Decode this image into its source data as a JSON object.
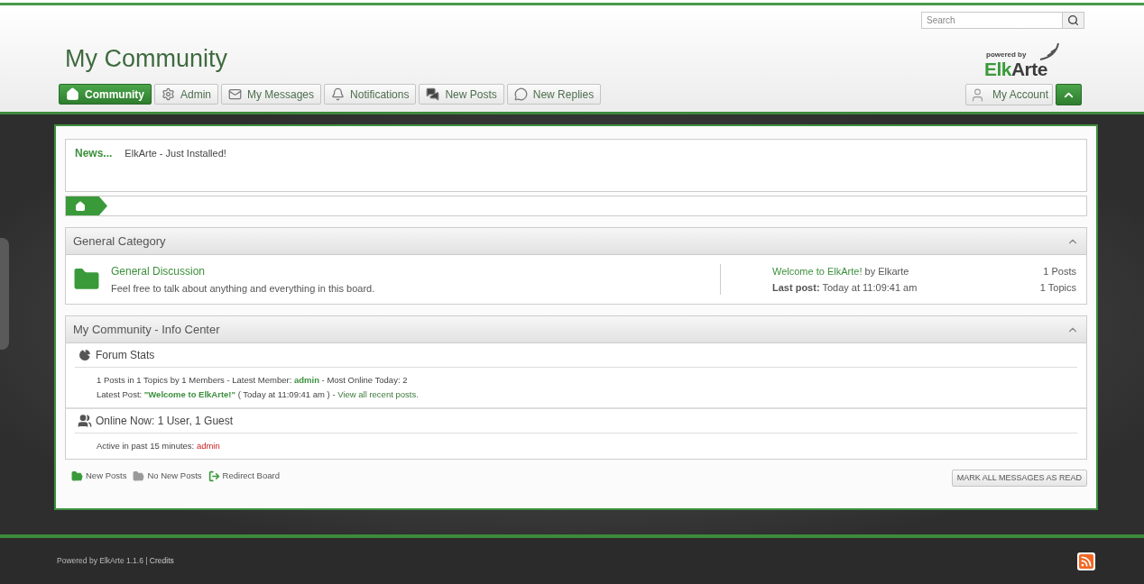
{
  "header": {
    "title": "My Community",
    "search": {
      "placeholder": "Search"
    },
    "logo": {
      "tagline": "powered by",
      "name_first": "Elk",
      "name_second": "Arte"
    }
  },
  "nav": [
    {
      "label": "Community",
      "kind": "home",
      "selected": true
    },
    {
      "label": "Admin",
      "kind": "admin",
      "selected": false
    },
    {
      "label": "My Messages",
      "kind": "messages",
      "selected": false
    },
    {
      "label": "Notifications",
      "kind": "notifications",
      "selected": false
    },
    {
      "label": "New Posts",
      "kind": "posts",
      "selected": false
    },
    {
      "label": "New Replies",
      "kind": "replies",
      "selected": false
    }
  ],
  "account": {
    "label": "My Account"
  },
  "news": {
    "label": "News...",
    "text": "ElkArte - Just Installed!"
  },
  "category": {
    "title": "General Category",
    "boards": [
      {
        "name": "General Discussion",
        "description": "Feel free to talk about anything and everything in this board.",
        "last_topic": "Welcome to ElkArte!",
        "last_by": " by Elkarte",
        "last_post": "**Last post:** Today at 11:09:41 am",
        "posts": "1 Posts",
        "topics": "1 Topics"
      }
    ]
  },
  "info_center": {
    "title": "My Community - Info Center",
    "sections": [
      {
        "kind": "stats",
        "title": "Forum Stats",
        "lines": [
          [
            {
              "kind": "text",
              "text": "1 Posts in 1 Topics by 1 Members - Latest Member: "
            },
            {
              "kind": "bold_link",
              "text": "admin"
            },
            {
              "kind": "text",
              "text": " - Most Online Today: 2"
            }
          ],
          [
            {
              "kind": "text",
              "text": "Latest Post: "
            },
            {
              "kind": "bold_link",
              "text": "\"Welcome to ElkArte!\""
            },
            {
              "kind": "text",
              "text": " ( Today at 11:09:41 am ) - "
            },
            {
              "kind": "link",
              "text": "View all recent posts."
            }
          ]
        ]
      },
      {
        "kind": "online",
        "title": "Online Now: 1 User, 1 Guest",
        "lines": [
          [
            {
              "kind": "text",
              "text": "Active in past 15 minutes: "
            },
            {
              "kind": "admin_link",
              "text": "admin"
            }
          ]
        ]
      }
    ]
  },
  "legend": [
    {
      "kind": "new",
      "label": "New Posts"
    },
    {
      "kind": "old",
      "label": "No New Posts"
    },
    {
      "kind": "redirect",
      "label": "Redirect Board"
    }
  ],
  "mark_read": "MARK ALL MESSAGES AS READ",
  "footer": [
    {
      "kind": "text",
      "text": "Powered by ElkArte 1.1.6 | "
    },
    {
      "kind": "link",
      "text": "Credits"
    }
  ]
}
